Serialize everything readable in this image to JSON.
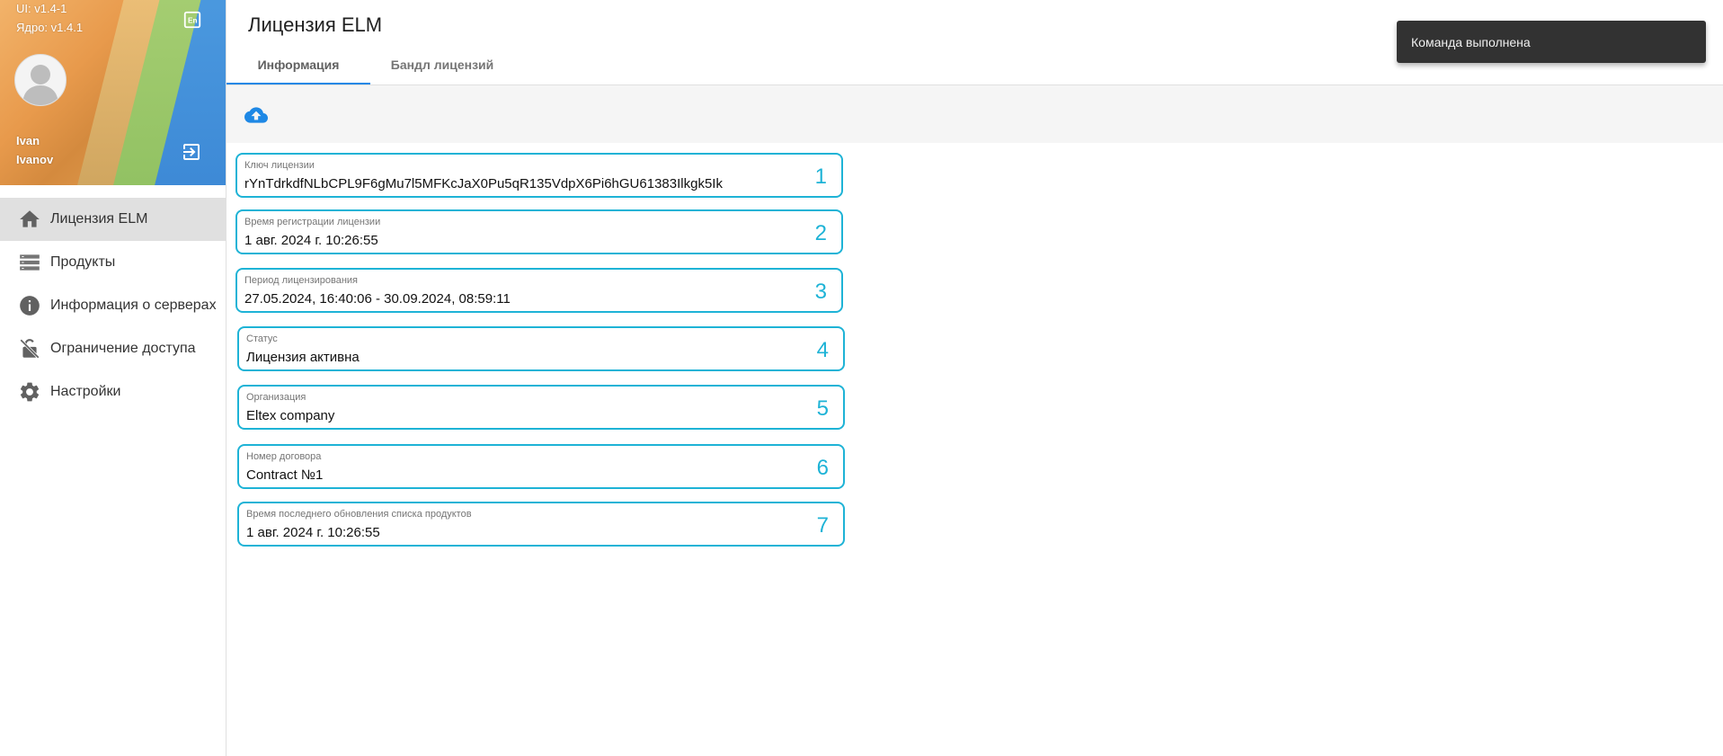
{
  "profile": {
    "ui_version": "UI: v1.4-1",
    "core_version": "Ядро: v1.4.1",
    "first_name": "Ivan",
    "last_name": "Ivanov"
  },
  "nav": {
    "items": [
      {
        "label": "Лицензия ELM",
        "icon": "home-icon",
        "active": true
      },
      {
        "label": "Продукты",
        "icon": "list-icon",
        "active": false
      },
      {
        "label": "Информация о серверах",
        "icon": "info-icon",
        "active": false
      },
      {
        "label": "Ограничение доступа",
        "icon": "lock-off-icon",
        "active": false
      },
      {
        "label": "Настройки",
        "icon": "gear-icon",
        "active": false
      }
    ]
  },
  "header": {
    "title": "Лицензия ELM",
    "tabs": [
      {
        "label": "Информация",
        "active": true
      },
      {
        "label": "Бандл лицензий",
        "active": false
      }
    ]
  },
  "fields": [
    {
      "label": "Ключ лицензии",
      "value": "rYnTdrkdfNLbCPL9F6gMu7l5MFKcJaX0Pu5qR135VdpX6Pi6hGU61383Ilkgk5Ik",
      "num": "1"
    },
    {
      "label": "Время регистрации лицензии",
      "value": "1 авг. 2024 г. 10:26:55",
      "num": "2"
    },
    {
      "label": "Период лицензирования",
      "value": "27.05.2024, 16:40:06 - 30.09.2024, 08:59:11",
      "num": "3"
    },
    {
      "label": "Статус",
      "value": "Лицензия активна",
      "num": "4"
    },
    {
      "label": "Организация",
      "value": "Eltex company",
      "num": "5"
    },
    {
      "label": "Номер договора",
      "value": "Contract №1",
      "num": "6"
    },
    {
      "label": "Время последнего обновления списка продуктов",
      "value": "1 авг. 2024 г. 10:26:55",
      "num": "7"
    }
  ],
  "toast": {
    "message": "Команда выполнена"
  },
  "colors": {
    "accent": "#1e88e5",
    "field_border": "#1eb3d6",
    "toast_bg": "#323232"
  }
}
